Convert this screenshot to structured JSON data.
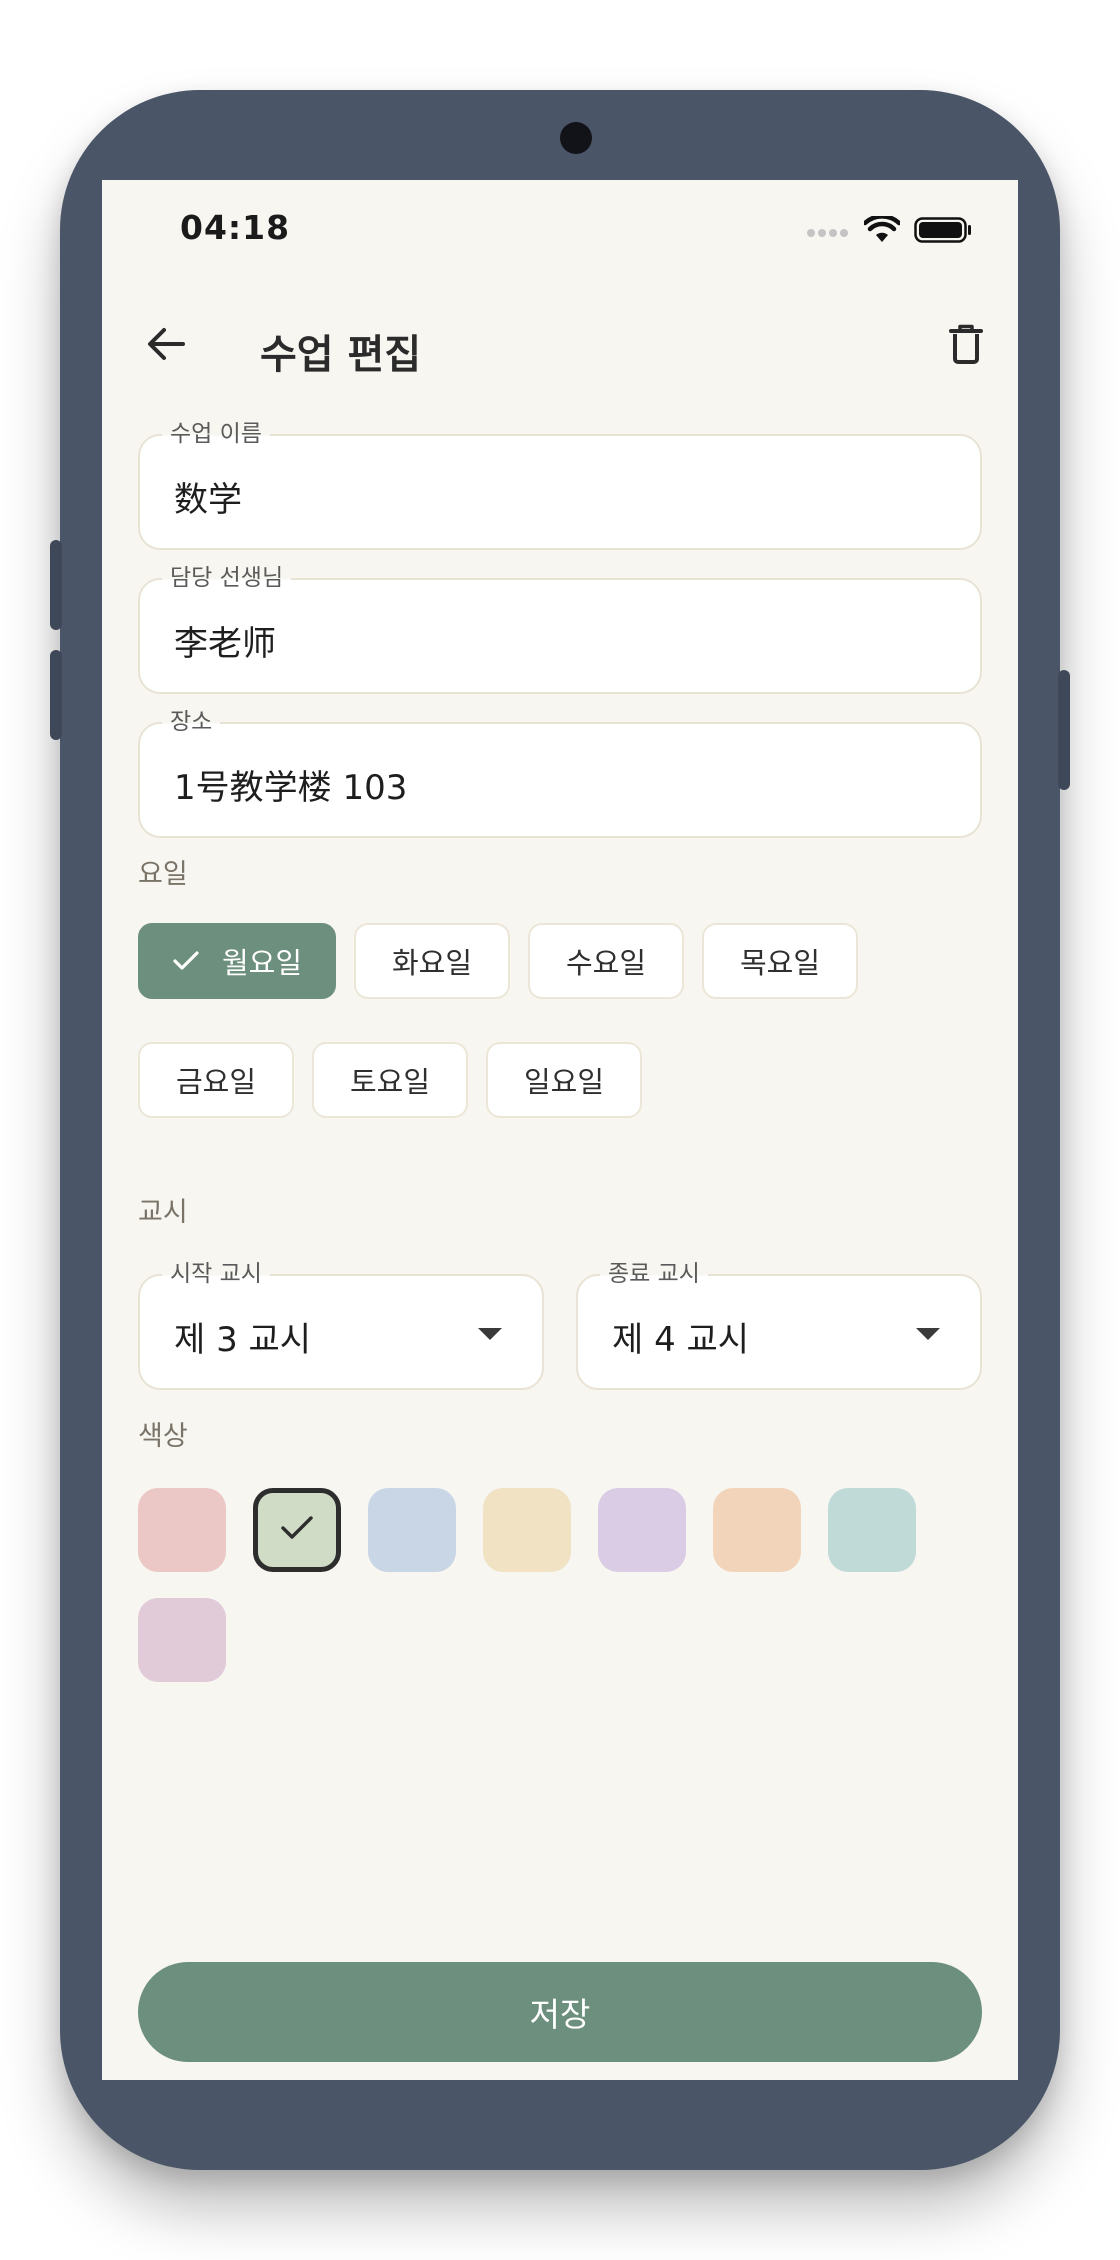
{
  "status_bar": {
    "time": "04:18",
    "icons": [
      "signal-dots-icon",
      "wifi-icon",
      "battery-icon"
    ]
  },
  "app_bar": {
    "back_icon": "arrow-left-icon",
    "title": "수업 편집",
    "delete_icon": "trash-icon"
  },
  "fields": {
    "class_name": {
      "label": "수업 이름",
      "value": "数学"
    },
    "teacher": {
      "label": "담당 선생님",
      "value": "李老师"
    },
    "location": {
      "label": "장소",
      "value": "1号教学楼 103"
    }
  },
  "days": {
    "label": "요일",
    "items": [
      {
        "label": "월요일",
        "selected": true
      },
      {
        "label": "화요일",
        "selected": false
      },
      {
        "label": "수요일",
        "selected": false
      },
      {
        "label": "목요일",
        "selected": false
      },
      {
        "label": "금요일",
        "selected": false
      },
      {
        "label": "토요일",
        "selected": false
      },
      {
        "label": "일요일",
        "selected": false
      }
    ]
  },
  "period": {
    "label": "교시",
    "start": {
      "label": "시작 교시",
      "value": "제 3 교시"
    },
    "end": {
      "label": "종료 교시",
      "value": "제 4 교시"
    }
  },
  "colors": {
    "label": "색상",
    "swatches": [
      {
        "hex": "#ebc8c6",
        "selected": false
      },
      {
        "hex": "#d0dcc6",
        "selected": true
      },
      {
        "hex": "#c8d6e6",
        "selected": false
      },
      {
        "hex": "#f0e2c3",
        "selected": false
      },
      {
        "hex": "#d9cce4",
        "selected": false
      },
      {
        "hex": "#f2d4bb",
        "selected": false
      },
      {
        "hex": "#c0dad7",
        "selected": false
      },
      {
        "hex": "#e2cbd8",
        "selected": false
      }
    ]
  },
  "save_button": {
    "label": "저장"
  },
  "theme": {
    "accent": "#6d8f7d",
    "background": "#f8f6f1",
    "frame": "#4a5568"
  }
}
